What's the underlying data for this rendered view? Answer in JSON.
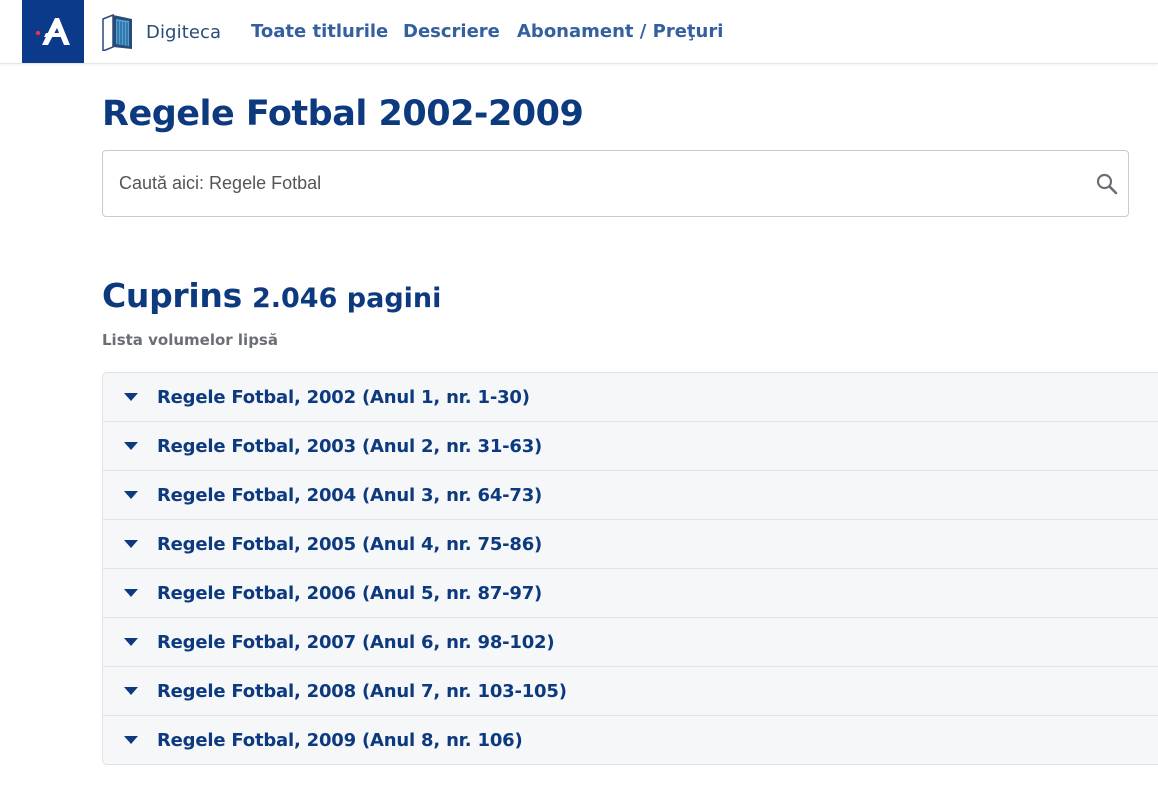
{
  "header": {
    "logo_icon": "letter-a-logo-icon",
    "digiteca_icon": "books-icon",
    "digiteca_label": "Digiteca",
    "nav": [
      {
        "label": "Toate titlurile"
      },
      {
        "label": "Descriere"
      },
      {
        "label": "Abonament / Preţuri"
      }
    ]
  },
  "page_title": "Regele Fotbal 2002-2009",
  "search": {
    "placeholder": "Caută aici: Regele Fotbal",
    "value": "",
    "icon": "search-icon"
  },
  "contents": {
    "title": "Cuprins",
    "count": "2.046 pagini",
    "missing_link": "Lista volumelor lipsă"
  },
  "volumes": [
    {
      "label": "Regele Fotbal, 2002 (Anul 1, nr. 1-30)"
    },
    {
      "label": "Regele Fotbal, 2003 (Anul 2, nr. 31-63)"
    },
    {
      "label": "Regele Fotbal, 2004 (Anul 3, nr. 64-73)"
    },
    {
      "label": "Regele Fotbal, 2005 (Anul 4, nr. 75-86)"
    },
    {
      "label": "Regele Fotbal, 2006 (Anul 5, nr. 87-97)"
    },
    {
      "label": "Regele Fotbal, 2007 (Anul 6, nr. 98-102)"
    },
    {
      "label": "Regele Fotbal, 2008 (Anul 7, nr. 103-105)"
    },
    {
      "label": "Regele Fotbal, 2009 (Anul 8, nr. 106)"
    }
  ],
  "colors": {
    "brand": "#0b3a8a",
    "heading": "#0d3a7f",
    "nav": "#3560a0",
    "accent_red": "#e8334a"
  }
}
